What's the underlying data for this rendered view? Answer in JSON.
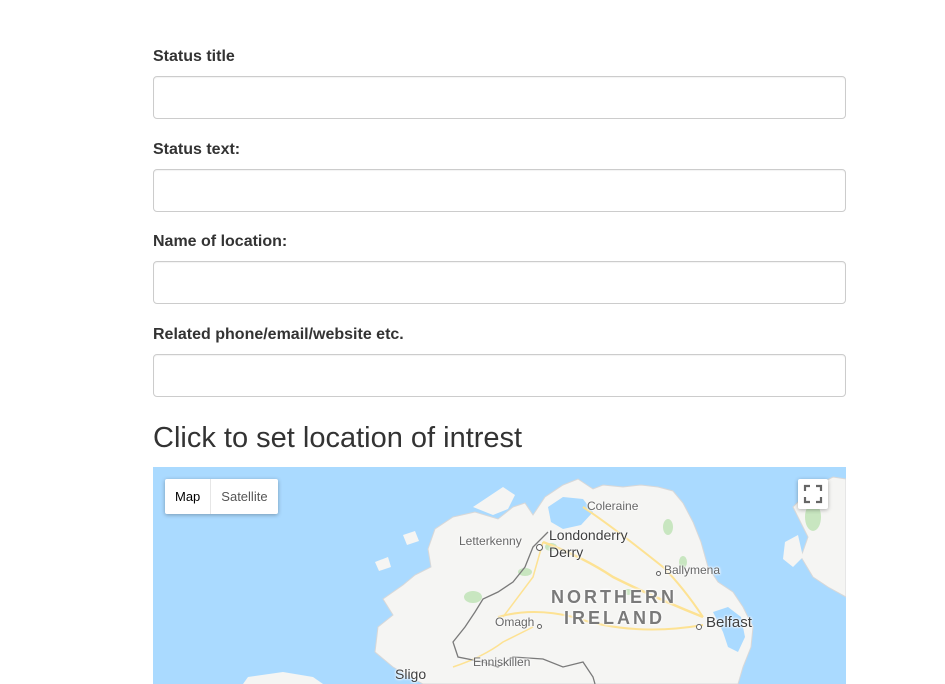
{
  "form": {
    "fields": [
      {
        "label": "Status title",
        "value": "",
        "placeholder": ""
      },
      {
        "label": "Status text:",
        "value": "",
        "placeholder": ""
      },
      {
        "label": "Name of location:",
        "value": "",
        "placeholder": ""
      },
      {
        "label": "Related phone/email/website etc.",
        "value": "",
        "placeholder": ""
      }
    ]
  },
  "map_section": {
    "heading": "Click to set location of intrest"
  },
  "map": {
    "type_map": "Map",
    "type_satellite": "Satellite",
    "fullscreen_icon": "fullscreen-icon",
    "places": {
      "coleraine": "Coleraine",
      "letterkenny": "Letterkenny",
      "londonderry": "Londonderry",
      "derry": "Derry",
      "ballymena": "Ballymena",
      "northern": "NORTHERN",
      "ireland": "IRELAND",
      "omagh": "Omagh",
      "belfast": "Belfast",
      "enniskillen": "Enniskillen",
      "sligo": "Sligo"
    },
    "colors": {
      "water": "#aadaff",
      "land": "#f5f5f3",
      "park": "#c8e6c0",
      "road": "#fde293",
      "border": "#7a7a7a"
    }
  }
}
